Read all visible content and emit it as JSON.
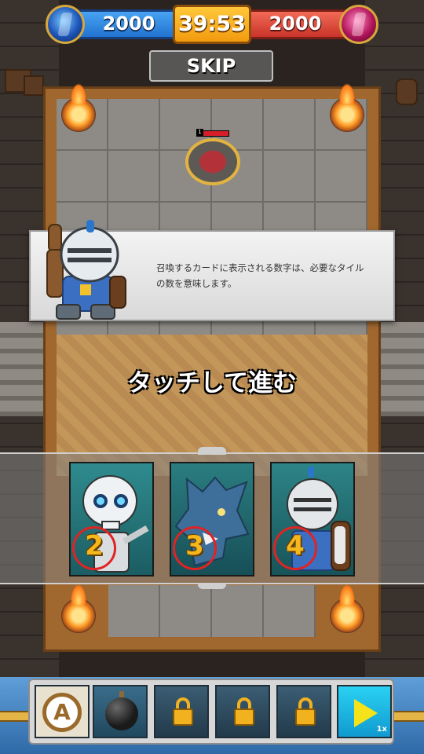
{
  "hud": {
    "blue_score": "2000",
    "red_score": "2000",
    "timer": "39:53",
    "skip_label": "SKIP"
  },
  "enemy": {
    "level": "1"
  },
  "tutorial": {
    "message_line1": "召喚するカードに表示される数字は、必要なタイル",
    "message_line2": "の数を意味します。",
    "tap_prompt": "タッチして進む"
  },
  "cards": [
    {
      "unit": "skeleton-icon",
      "cost": "2"
    },
    {
      "unit": "wolf-icon",
      "cost": "3"
    },
    {
      "unit": "knight-icon",
      "cost": "4"
    }
  ],
  "action_bar": {
    "auto_label": "A",
    "speed_label": "1x",
    "slots": [
      "auto-icon",
      "bomb-icon",
      "lock-icon",
      "lock-icon",
      "lock-icon",
      "play-icon"
    ]
  },
  "colors": {
    "blue_team": "#2a7fd8",
    "red_team": "#d8403a",
    "timer": "#f4a91b",
    "cost_number": "#f5b81c",
    "cost_ring": "#e02323"
  }
}
